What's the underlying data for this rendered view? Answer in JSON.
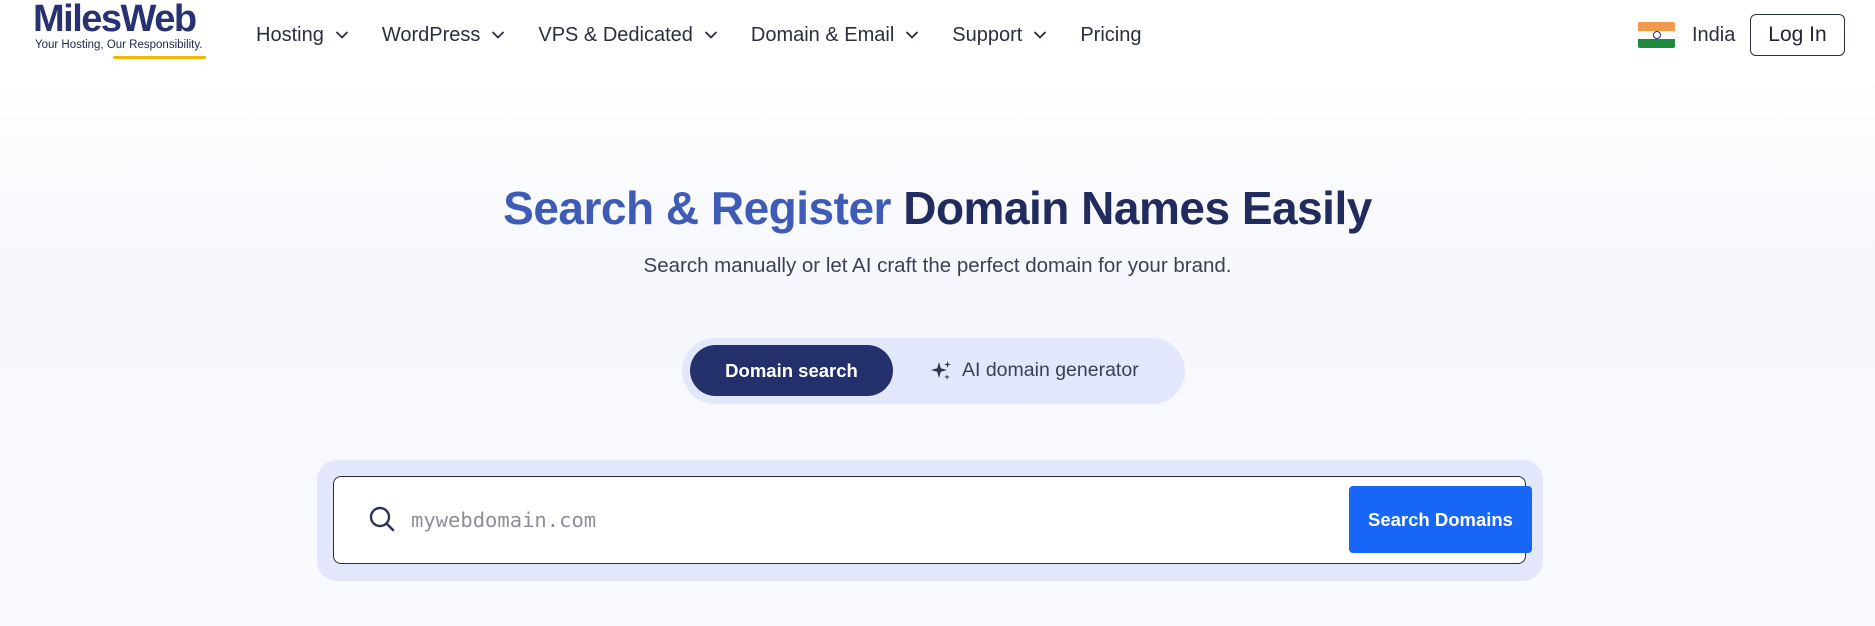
{
  "brand": {
    "name": "MilesWeb",
    "tagline": "Your Hosting, Our Responsibility."
  },
  "nav": {
    "items": [
      {
        "label": "Hosting",
        "has_dropdown": true
      },
      {
        "label": "WordPress",
        "has_dropdown": true
      },
      {
        "label": "VPS & Dedicated",
        "has_dropdown": true
      },
      {
        "label": "Domain & Email",
        "has_dropdown": true
      },
      {
        "label": "Support",
        "has_dropdown": true
      },
      {
        "label": "Pricing",
        "has_dropdown": false
      }
    ],
    "country": "India",
    "login_label": "Log In"
  },
  "hero": {
    "title_accent": "Search & Register",
    "title_rest": " Domain Names Easily",
    "subtitle": "Search manually or let AI craft the perfect domain for your brand."
  },
  "toggle": {
    "active_label": "Domain search",
    "ai_label": "AI domain generator"
  },
  "search": {
    "placeholder": "mywebdomain.com",
    "value": "",
    "button_label": "Search Domains"
  },
  "colors": {
    "brand_navy": "#23306b",
    "accent_blue": "#3e5bb8",
    "button_blue": "#1766f5",
    "tagline_underline": "#f2b705",
    "panel_bg": "#e2e7fb"
  },
  "icons": [
    "chevron-down-icon",
    "india-flag-icon",
    "sparkles-icon",
    "search-icon"
  ]
}
